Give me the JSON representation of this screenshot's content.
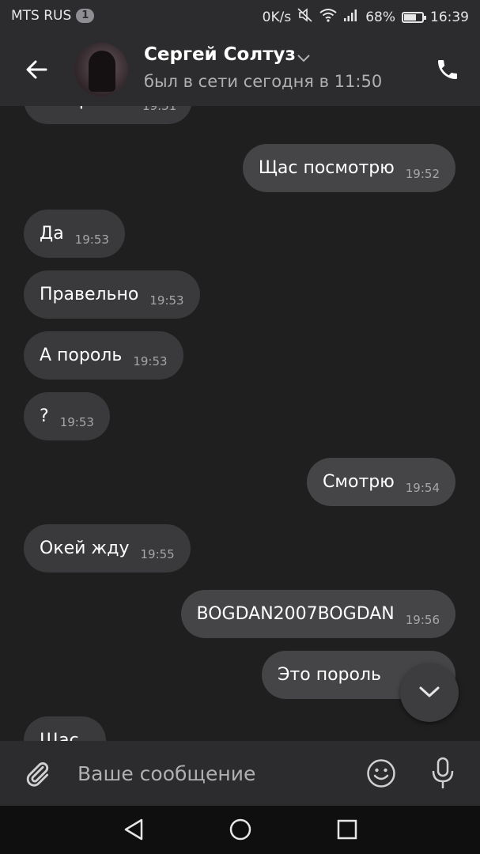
{
  "statusbar": {
    "carrier": "MTS RUS",
    "sim_badge": "1",
    "speed": "0K/s",
    "battery": "68%",
    "battery_level": 0.68,
    "time": "16:39"
  },
  "header": {
    "name": "Сергей Солтуз",
    "last_seen": "был в сети сегодня в 11:50"
  },
  "messages": [
    {
      "dir": "in",
      "text": "А пороль?",
      "time": "19:51"
    },
    {
      "dir": "out",
      "text": "Щас посмотрю",
      "time": "19:52"
    },
    {
      "dir": "in",
      "text": "Да",
      "time": "19:53"
    },
    {
      "dir": "in",
      "text": "Правельно",
      "time": "19:53"
    },
    {
      "dir": "in",
      "text": "А пороль",
      "time": "19:53"
    },
    {
      "dir": "in",
      "text": "?",
      "time": "19:53"
    },
    {
      "dir": "out",
      "text": "Смотрю",
      "time": "19:54"
    },
    {
      "dir": "in",
      "text": "Окей жду",
      "time": "19:55"
    },
    {
      "dir": "out",
      "text": "BOGDAN2007BOGDAN",
      "time": "19:56"
    },
    {
      "dir": "out",
      "text": "Это пороль",
      "time": ""
    },
    {
      "dir": "in",
      "text": "Щас",
      "time": ""
    }
  ],
  "composer": {
    "placeholder": "Ваше сообщение"
  }
}
